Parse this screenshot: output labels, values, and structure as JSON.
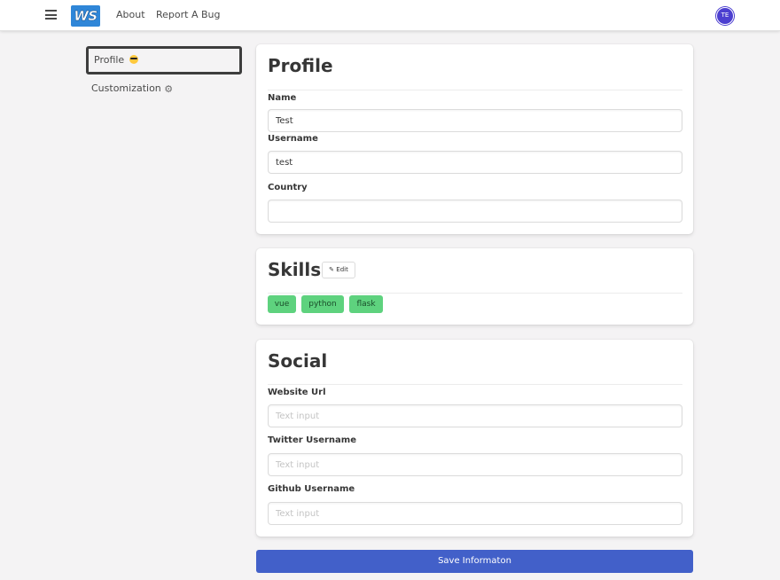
{
  "navbar": {
    "logo_text": "WS",
    "links": [
      {
        "label": "About"
      },
      {
        "label": "Report A Bug"
      }
    ],
    "avatar_initials": "TE"
  },
  "sidebar": {
    "items": [
      {
        "label": "Profile",
        "active": true,
        "icon": "sunglasses-emoji-icon"
      },
      {
        "label": "Customization",
        "active": false,
        "icon": "gear-icon"
      }
    ]
  },
  "profile": {
    "title": "Profile",
    "fields": [
      {
        "label": "Name",
        "value": "Test",
        "placeholder": ""
      },
      {
        "label": "Username",
        "value": "test",
        "placeholder": ""
      },
      {
        "label": "Country",
        "value": "",
        "placeholder": ""
      }
    ]
  },
  "skills": {
    "title": "Skills",
    "edit_label": "Edit",
    "tags": [
      "vue",
      "python",
      "flask"
    ],
    "tag_color": "#5ed27e"
  },
  "social": {
    "title": "Social",
    "fields": [
      {
        "label": "Website Url",
        "value": "",
        "placeholder": "Text input"
      },
      {
        "label": "Twitter Username",
        "value": "",
        "placeholder": "Text input"
      },
      {
        "label": "Github Username",
        "value": "",
        "placeholder": "Text input"
      }
    ]
  },
  "save_label": "Save Informaton",
  "colors": {
    "accent": "#4260c9",
    "logo": "#2f86d8",
    "avatar": "#4c3fd0"
  }
}
